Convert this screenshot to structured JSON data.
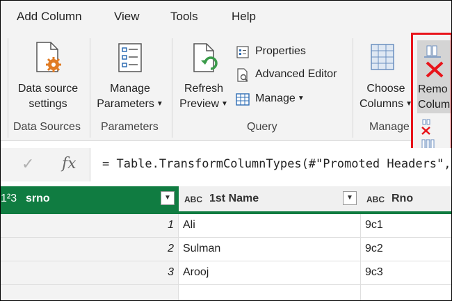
{
  "menu": {
    "add_column": "Add Column",
    "view": "View",
    "tools": "Tools",
    "help": "Help"
  },
  "ribbon": {
    "data_source_settings": {
      "line1": "Data source",
      "line2": "settings"
    },
    "group_data_sources": "Data Sources",
    "manage_parameters": {
      "line1": "Manage",
      "line2": "Parameters"
    },
    "group_parameters": "Parameters",
    "refresh_preview": {
      "line1": "Refresh",
      "line2": "Preview"
    },
    "properties": "Properties",
    "advanced_editor": "Advanced Editor",
    "manage": "Manage",
    "group_query": "Query",
    "choose_columns": {
      "line1": "Choose",
      "line2": "Columns"
    },
    "group_manage": "Manage",
    "remove_columns": {
      "line1": "Remo",
      "line2": "Colum"
    }
  },
  "formula_bar": {
    "check": "✓",
    "fx": "fx",
    "formula": "= Table.TransformColumnTypes(#\"Promoted Headers\","
  },
  "table": {
    "columns": [
      {
        "type_icon": "1²3",
        "name": "srno"
      },
      {
        "type_icon": "ABC",
        "name": "1st Name"
      },
      {
        "type_icon": "ABC",
        "name": "Rno"
      }
    ],
    "rows": [
      {
        "srno": "1",
        "name": "Ali",
        "rno": "9c1"
      },
      {
        "srno": "2",
        "name": "Sulman",
        "rno": "9c2"
      },
      {
        "srno": "3",
        "name": "Arooj",
        "rno": "9c3"
      }
    ]
  },
  "colors": {
    "accent_green": "#107c41",
    "highlight_red": "#e8141b",
    "icon_orange": "#e07b24",
    "icon_green": "#3a9b4a",
    "icon_blue": "#2e6db4"
  }
}
